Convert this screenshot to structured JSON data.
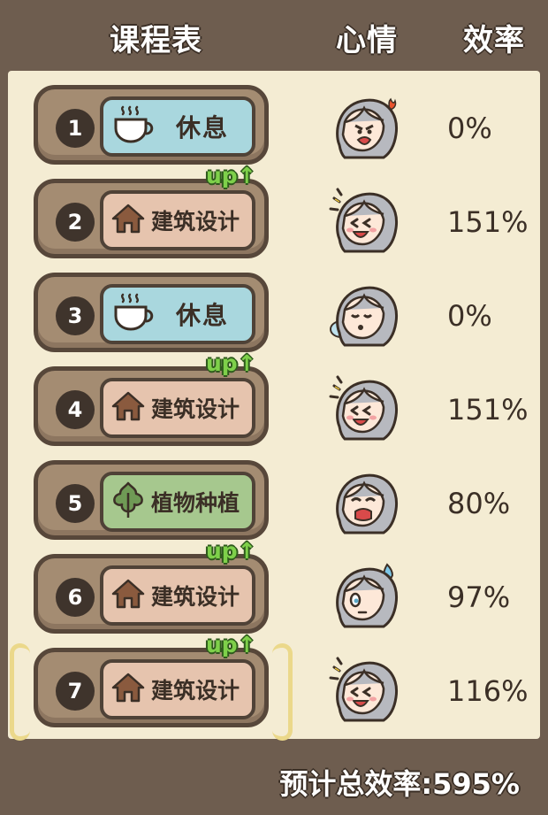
{
  "header": {
    "schedule": "课程表",
    "mood": "心情",
    "efficiency": "效率"
  },
  "rows": [
    {
      "num": "1",
      "course": "休息",
      "type": "rest",
      "icon": "cup-icon",
      "up": "",
      "mood": "angry-face-icon",
      "eff": "0%",
      "selected": false
    },
    {
      "num": "2",
      "course": "建筑设计",
      "type": "arch",
      "icon": "house-icon",
      "up": "up",
      "mood": "happy-face-icon",
      "eff": "151%",
      "selected": false
    },
    {
      "num": "3",
      "course": "休息",
      "type": "rest",
      "icon": "cup-icon",
      "up": "",
      "mood": "sleeping-face-icon",
      "eff": "0%",
      "selected": false
    },
    {
      "num": "4",
      "course": "建筑设计",
      "type": "arch",
      "icon": "house-icon",
      "up": "up",
      "mood": "happy-face-icon",
      "eff": "151%",
      "selected": false
    },
    {
      "num": "5",
      "course": "植物种植",
      "type": "plant",
      "icon": "leaf-icon",
      "up": "",
      "mood": "crying-face-icon",
      "eff": "80%",
      "selected": false
    },
    {
      "num": "6",
      "course": "建筑设计",
      "type": "arch",
      "icon": "house-icon",
      "up": "up",
      "mood": "sweat-face-icon",
      "eff": "97%",
      "selected": false
    },
    {
      "num": "7",
      "course": "建筑设计",
      "type": "arch",
      "icon": "house-icon",
      "up": "up",
      "mood": "happy-face-icon",
      "eff": "116%",
      "selected": true
    }
  ],
  "footer": {
    "total": "预计总效率:595%"
  },
  "colors": {
    "rest": "#a9d7de",
    "arch": "#e6c4ae",
    "plant": "#a6c88e",
    "frame": "#6e5d4f",
    "panel": "#f4ecd3"
  }
}
